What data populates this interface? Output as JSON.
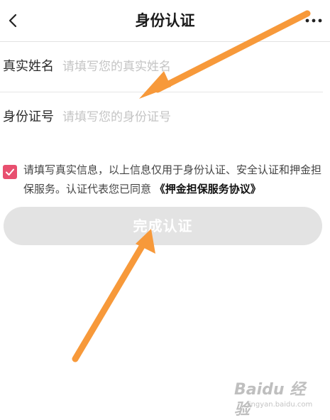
{
  "header": {
    "title": "身份认证"
  },
  "form": {
    "name_label": "真实姓名",
    "name_placeholder": "请填写您的真实姓名",
    "id_label": "身份证号",
    "id_placeholder": "请填写您的身份证号"
  },
  "agreement": {
    "checked": true,
    "text": "请填写真实信息，以上信息仅用于身份认证、安全认证和押金担保服务。认证代表您已同意",
    "link_label": "《押金担保服务协议》"
  },
  "submit": {
    "label": "完成认证",
    "enabled": false
  },
  "watermark": {
    "brand": "Baidu 经验",
    "site": "jingyan.baidu.com"
  },
  "colors": {
    "accent": "#e84f6f",
    "annotation_arrow": "#f7993a",
    "disabled_button": "#e3e3e3"
  },
  "icons": {
    "back": "chevron-left-icon",
    "more": "more-dots-icon",
    "checkbox": "checkmark-icon"
  }
}
